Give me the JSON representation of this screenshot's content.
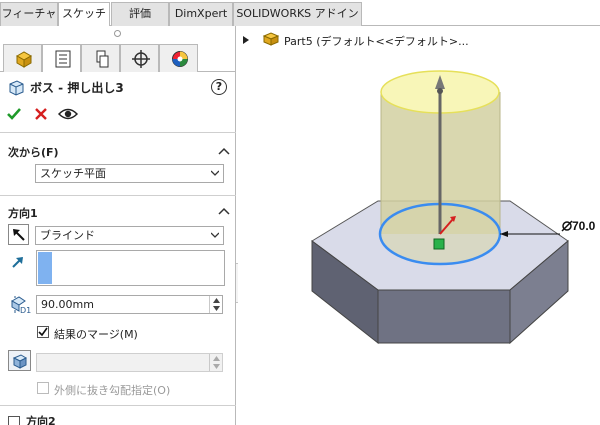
{
  "tabs": [
    {
      "label": "フィーチャー",
      "active": false
    },
    {
      "label": "スケッチ",
      "active": true
    },
    {
      "label": "評価",
      "active": false
    },
    {
      "label": "DimXpert",
      "active": false
    },
    {
      "label": "SOLIDWORKS アドイン",
      "active": false
    }
  ],
  "panel_tabs": [
    "feature-manager-icon",
    "property-manager-icon",
    "configuration-manager-icon",
    "dimxpert-manager-icon",
    "display-manager-icon"
  ],
  "property": {
    "title": "ボス - 押し出し3",
    "help": "?"
  },
  "from_section": {
    "header": "次から(F)",
    "selected": "スケッチ平面"
  },
  "direction1": {
    "header": "方向1",
    "end_condition": "ブラインド",
    "depth": "90.00mm",
    "merge_label": "結果のマージ(M)",
    "merge_checked": true,
    "draft_label": "外側に抜き勾配指定(O)",
    "draft_checked": false,
    "depth_icon_label": "D1"
  },
  "direction2": {
    "header": "方向2",
    "checked": false
  },
  "viewport": {
    "tree_label": "Part5 (デフォルト<<デフォルト>...",
    "dimension_label": "70.0",
    "colors": {
      "cylinder_top": "#f8f6b8",
      "cylinder_side": "#cfcd9a",
      "hex_top": "#d9dbe9",
      "hex_side": "#6f7283",
      "selection_blue": "#3a8cf0"
    }
  }
}
